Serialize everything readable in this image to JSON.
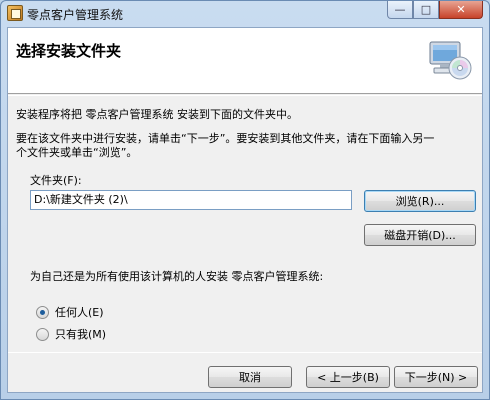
{
  "window": {
    "title": "零点客户管理系统",
    "minimize_glyph": "—",
    "maximize_glyph": "□",
    "close_glyph": "✕"
  },
  "header": {
    "title": "选择安装文件夹",
    "icon": "computer-with-cd-icon"
  },
  "body": {
    "line1": "安装程序将把 零点客户管理系统 安装到下面的文件夹中。",
    "line2a": "要在该文件夹中进行安装，请单击“下一步”。要安装到其他文件夹，请在下面输入另一",
    "line2b": "个文件夹或单击“浏览”。"
  },
  "folder": {
    "label": "文件夹(F):",
    "value": "D:\\新建文件夹 (2)\\"
  },
  "buttons": {
    "browse": "浏览(R)...",
    "disk_cost": "磁盘开销(D)...",
    "cancel": "取消",
    "back": "< 上一步(B)",
    "next": "下一步(N) >"
  },
  "install_for": {
    "question": "为自己还是为所有使用该计算机的人安装 零点客户管理系统:",
    "options": [
      {
        "label": "任何人(E)",
        "checked": true
      },
      {
        "label": "只有我(M)",
        "checked": false
      }
    ]
  }
}
